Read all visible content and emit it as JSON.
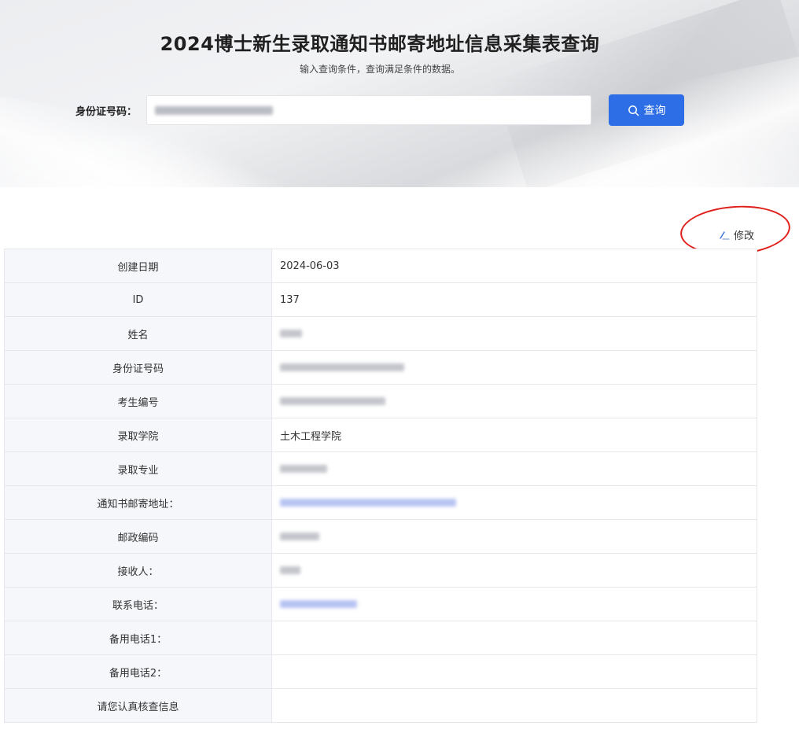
{
  "header": {
    "title": "2024博士新生录取通知书邮寄地址信息采集表查询",
    "subtitle": "输入查询条件，查询满足条件的数据。"
  },
  "search": {
    "label": "身份证号码：",
    "value": "",
    "button_label": "查询",
    "button_icon": "search-icon",
    "button_color": "#2d6ee6"
  },
  "actions": {
    "edit_label": "修改",
    "edit_icon": "edit-pen-icon"
  },
  "record": {
    "rows": [
      {
        "label": "创建日期",
        "value": "2024-06-03"
      },
      {
        "label": "ID",
        "value": "137"
      },
      {
        "label": "姓名",
        "value": ""
      },
      {
        "label": "身份证号码",
        "value": ""
      },
      {
        "label": "考生编号",
        "value": ""
      },
      {
        "label": "录取学院",
        "value": "土木工程学院"
      },
      {
        "label": "录取专业",
        "value": ""
      },
      {
        "label": "通知书邮寄地址：",
        "value": ""
      },
      {
        "label": "邮政编码",
        "value": ""
      },
      {
        "label": "接收人：",
        "value": ""
      },
      {
        "label": "联系电话：",
        "value": ""
      },
      {
        "label": "备用电话1：",
        "value": ""
      },
      {
        "label": "备用电话2：",
        "value": ""
      },
      {
        "label": "请您认真核查信息",
        "value": ""
      }
    ]
  },
  "colors": {
    "accent": "#2d6ee6",
    "annotation": "#e0201b"
  }
}
